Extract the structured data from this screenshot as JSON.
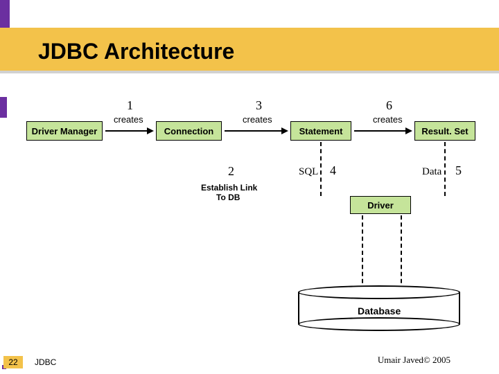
{
  "title": "JDBC Architecture",
  "boxes": {
    "driver_manager": "Driver Manager",
    "connection": "Connection",
    "statement": "Statement",
    "resultset": "Result. Set",
    "driver": "Driver",
    "database": "Database"
  },
  "labels": {
    "creates1": "creates",
    "creates3": "creates",
    "creates6": "creates",
    "n1": "1",
    "n2": "2",
    "n3": "3",
    "n4": "4",
    "n5": "5",
    "n6": "6",
    "sql": "SQL",
    "data": "Data",
    "establish": "Establish Link",
    "establish2": "To DB"
  },
  "footer": {
    "page": "22",
    "tag": "JDBC",
    "copyright": "Umair Javed© 2005"
  }
}
